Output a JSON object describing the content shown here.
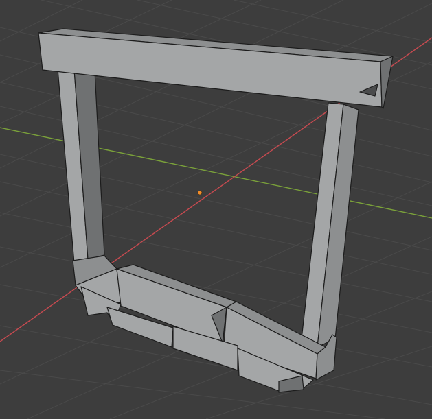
{
  "viewport": {
    "background": "#3d3d3d",
    "grid_color": "#4a4a4a",
    "x_axis_color": "#c74a50",
    "y_axis_color": "#7ba23a",
    "origin_color": "#f28c28",
    "mesh_face_light": "#a4a6a7",
    "mesh_face_mid": "#8d8f90",
    "mesh_face_dark": "#6f7172",
    "mesh_edge": "#1c1c1c"
  },
  "scene": {
    "object": "stone-doorway-frame-mesh",
    "origin_marker": "object-origin-dot"
  }
}
